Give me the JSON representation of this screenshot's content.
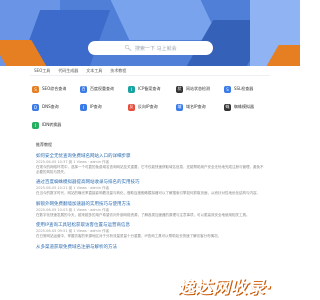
{
  "search": {
    "placeholder": "搜索一下 马上就会"
  },
  "nav": {
    "items": [
      "SEO工具",
      "代码生成器",
      "文本工具",
      "技术教程"
    ]
  },
  "tools": [
    {
      "label": "SEO综合查询",
      "icon": "seo-icon",
      "color": "#e67e22",
      "glyph": "S"
    },
    {
      "label": "百度权重查询",
      "icon": "baidu-icon",
      "color": "#3b7be8",
      "glyph": "百"
    },
    {
      "label": "ICP备案查询",
      "icon": "icp-icon",
      "color": "#1aa3a3",
      "glyph": "I"
    },
    {
      "label": "网站状态检测",
      "icon": "status-icon",
      "color": "#333333",
      "glyph": "状"
    },
    {
      "label": "SSL检查器",
      "icon": "ssl-icon",
      "color": "#3b7be8",
      "glyph": "S"
    },
    {
      "label": "DNS查询",
      "icon": "dns-icon",
      "color": "#3b7be8",
      "glyph": "D"
    },
    {
      "label": "IP查询",
      "icon": "ip-icon",
      "color": "#3b7be8",
      "glyph": "I"
    },
    {
      "label": "反向IP查询",
      "icon": "reverse-ip-icon",
      "color": "#e74c3c",
      "glyph": "反"
    },
    {
      "label": "域名IP查询",
      "icon": "domain-ip-icon",
      "color": "#3b7be8",
      "glyph": "域"
    },
    {
      "label": "蜘蛛模拟器",
      "icon": "spider-icon",
      "color": "#333333",
      "glyph": "蛛"
    },
    {
      "label": "IDN转换器",
      "icon": "idn-icon",
      "color": "#27ae60",
      "glyph": "I"
    }
  ],
  "section_title": "推荐教程",
  "articles": [
    {
      "title": "如何安全无忧查询免费域名网站入口的详细步骤",
      "meta": "2025-06-05 10:37 阅 1 Views · admin 作者",
      "desc": "在现今的网络环境中，选择一个可靠的免费域名查询网站至关重要，它不仅能快速获取域名信息，还能帮助用户安全无忧地完成注册与管理，避免不必要的风险与损失。"
    },
    {
      "title": "通过百度蜘蛛模拟器提高网站收录与排名的实用技巧",
      "meta": "2025-06-05 10:21 阅 1 Views · admin 作者",
      "desc": "在当今的数字时代，网站的曝光率直接影响着流量与转化，借助百度蜘蛛模拟器可以了解搜索引擎如何抓取页面，从而针对性地优化结构与内容。"
    },
    {
      "title": "解锁外网免费翻墙加速器的实用技巧与使用方法",
      "meta": "2025-06-05 10:03 阅 1 Views · admin 作者",
      "desc": "在数字化快速发展的今天，越来越多的用户希望访问外部网络资源，了解各类加速器的原理与注意事项，可以更高效安全地使用相关工具。"
    },
    {
      "title": "使用IP查询工具轻松获取访客位置与运营商信息",
      "meta": "2025-06-05 09:51 阅 1 Views · admin 作者",
      "desc": "在日常网站运营中，掌握访客的来源地区对于分析流量质量十分重要，IP查询工具可以帮助站长快速了解访客分布情况。"
    },
    {
      "title": "从多渠道获取免费域名注册与解析的方法",
      "meta": "",
      "desc": ""
    }
  ],
  "watermark": "逸达网收录·"
}
